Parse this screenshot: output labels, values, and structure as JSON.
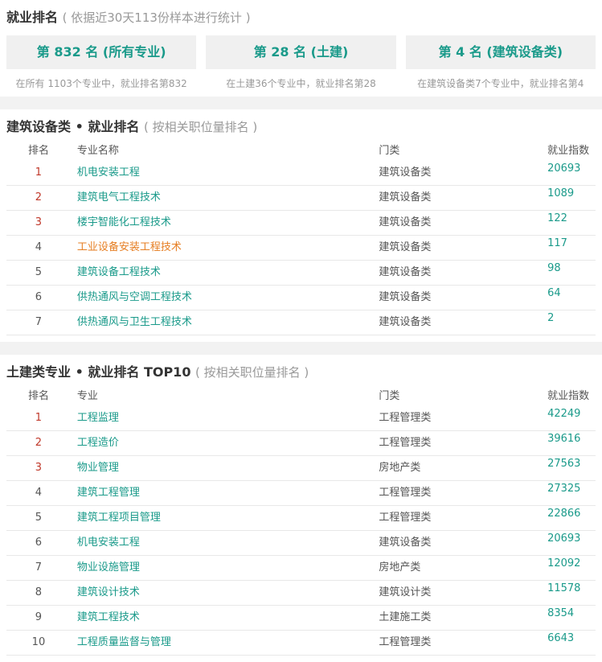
{
  "overview": {
    "title": "就业排名",
    "subtitle": "( 依据近30天113份样本进行统计 )",
    "cards": [
      {
        "label": "第 832 名 (所有专业)",
        "desc": "在所有 1103个专业中，就业排名第832"
      },
      {
        "label": "第 28 名 (土建)",
        "desc": "在土建36个专业中，就业排名第28"
      },
      {
        "label": "第 4 名 (建筑设备类)",
        "desc": "在建筑设备类7个专业中，就业排名第4"
      }
    ]
  },
  "section1": {
    "title": "建筑设备类 • 就业排名",
    "subtitle": "( 按相关职位量排名 )",
    "headers": {
      "rank": "排名",
      "name": "专业名称",
      "category": "门类",
      "index": "就业指数"
    },
    "rows": [
      {
        "rank": "1",
        "name": "机电安装工程",
        "category": "建筑设备类",
        "index": "20693"
      },
      {
        "rank": "2",
        "name": "建筑电气工程技术",
        "category": "建筑设备类",
        "index": "1089"
      },
      {
        "rank": "3",
        "name": "楼宇智能化工程技术",
        "category": "建筑设备类",
        "index": "122"
      },
      {
        "rank": "4",
        "name": "工业设备安装工程技术",
        "category": "建筑设备类",
        "index": "117"
      },
      {
        "rank": "5",
        "name": "建筑设备工程技术",
        "category": "建筑设备类",
        "index": "98"
      },
      {
        "rank": "6",
        "name": "供热通风与空调工程技术",
        "category": "建筑设备类",
        "index": "64"
      },
      {
        "rank": "7",
        "name": "供热通风与卫生工程技术",
        "category": "建筑设备类",
        "index": "2"
      }
    ]
  },
  "section2": {
    "title": "土建类专业 • 就业排名 TOP10",
    "subtitle": "( 按相关职位量排名 )",
    "headers": {
      "rank": "排名",
      "name": "专业",
      "category": "门类",
      "index": "就业指数"
    },
    "rows": [
      {
        "rank": "1",
        "name": "工程监理",
        "category": "工程管理类",
        "index": "42249"
      },
      {
        "rank": "2",
        "name": "工程造价",
        "category": "工程管理类",
        "index": "39616"
      },
      {
        "rank": "3",
        "name": "物业管理",
        "category": "房地产类",
        "index": "27563"
      },
      {
        "rank": "4",
        "name": "建筑工程管理",
        "category": "工程管理类",
        "index": "27325"
      },
      {
        "rank": "5",
        "name": "建筑工程项目管理",
        "category": "工程管理类",
        "index": "22866"
      },
      {
        "rank": "6",
        "name": "机电安装工程",
        "category": "建筑设备类",
        "index": "20693"
      },
      {
        "rank": "7",
        "name": "物业设施管理",
        "category": "房地产类",
        "index": "12092"
      },
      {
        "rank": "8",
        "name": "建筑设计技术",
        "category": "建筑设计类",
        "index": "11578"
      },
      {
        "rank": "9",
        "name": "建筑工程技术",
        "category": "土建施工类",
        "index": "8354"
      },
      {
        "rank": "10",
        "name": "工程质量监督与管理",
        "category": "工程管理类",
        "index": "6643"
      }
    ]
  },
  "colors": {
    "accent": "#1a9a8a",
    "top_rank": "#c0392b",
    "highlight": "#e67e22"
  }
}
